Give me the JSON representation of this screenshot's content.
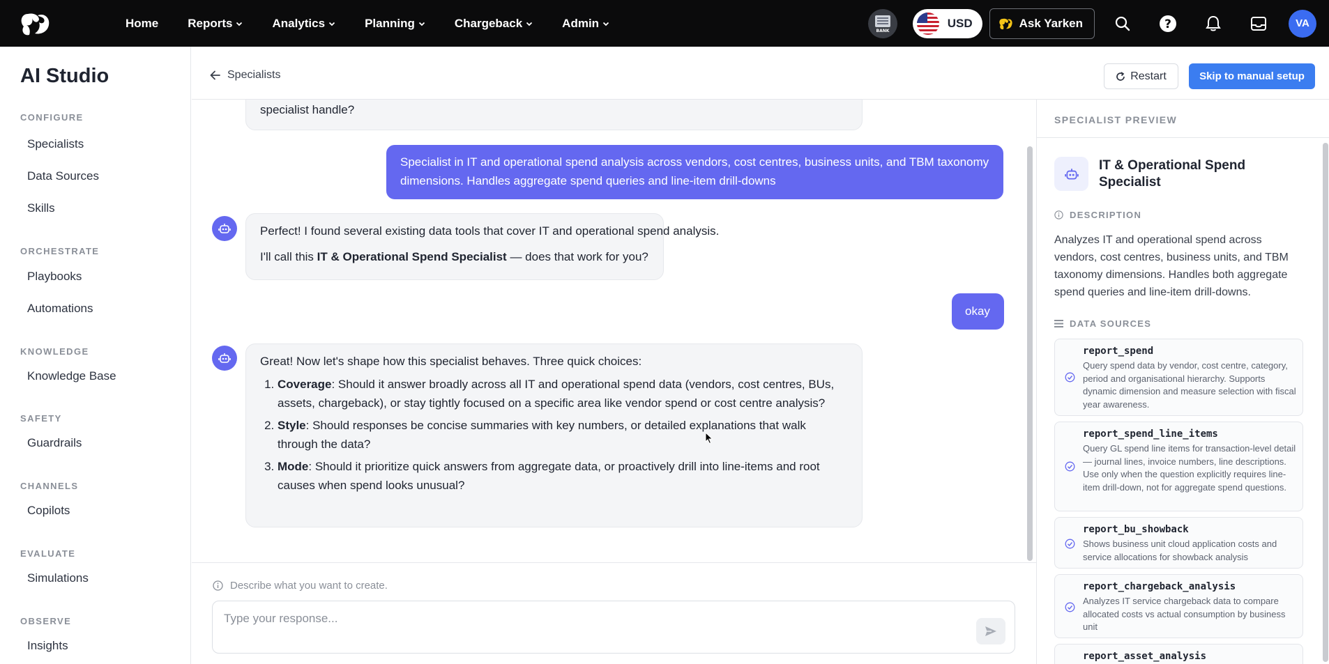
{
  "nav": {
    "links": [
      "Home",
      "Reports",
      "Analytics",
      "Planning",
      "Chargeback",
      "Admin"
    ],
    "bank_label": "BANK",
    "currency": "USD",
    "ask_label": "Ask Yarken",
    "avatar_initials": "VA",
    "colors": {
      "background": "#0b0b0c",
      "avatar": "#3b6cf1"
    }
  },
  "sidebar": {
    "title": "AI Studio",
    "sections": [
      {
        "label": "CONFIGURE",
        "items": [
          "Specialists",
          "Data Sources",
          "Skills"
        ]
      },
      {
        "label": "ORCHESTRATE",
        "items": [
          "Playbooks",
          "Automations"
        ]
      },
      {
        "label": "KNOWLEDGE",
        "items": [
          "Knowledge Base"
        ]
      },
      {
        "label": "SAFETY",
        "items": [
          "Guardrails"
        ]
      },
      {
        "label": "CHANNELS",
        "items": [
          "Copilots"
        ]
      },
      {
        "label": "EVALUATE",
        "items": [
          "Simulations"
        ]
      },
      {
        "label": "OBSERVE",
        "items": [
          "Insights"
        ]
      }
    ]
  },
  "header": {
    "back_label": "Specialists",
    "restart_label": "Restart",
    "skip_label": "Skip to manual setup",
    "accent": "#3b7df0"
  },
  "chat": {
    "partial_ai_tail": "specialist handle?",
    "user_msg_1": "Specialist in IT and operational spend analysis across vendors, cost centres, business units, and TBM taxonomy dimensions. Handles aggregate spend queries and line-item drill-downs",
    "ai_msg_2": {
      "line1": "Perfect! I found several existing data tools that cover IT and operational spend analysis.",
      "line2_pre": "I'll call this ",
      "line2_bold": "IT & Operational Spend Specialist",
      "line2_post": " — does that work for you?"
    },
    "user_msg_2": "okay",
    "ai_msg_3": {
      "intro": "Great! Now let's shape how this specialist behaves. Three quick choices:",
      "choices": [
        {
          "term": "Coverage",
          "text": ": Should it answer broadly across all IT and operational spend data (vendors, cost centres, BUs, assets, chargeback), or stay tightly focused on a specific area like vendor spend or cost centre analysis?"
        },
        {
          "term": "Style",
          "text": ": Should responses be concise summaries with key numbers, or detailed explanations that walk through the data?"
        },
        {
          "term": "Mode",
          "text": ": Should it prioritize quick answers from aggregate data, or proactively drill into line-items and root causes when spend looks unusual?"
        }
      ]
    },
    "user_color": "#6468f0"
  },
  "composer": {
    "hint": "Describe what you want to create.",
    "placeholder": "Type your response..."
  },
  "preview": {
    "heading": "SPECIALIST PREVIEW",
    "name": "IT & Operational Spend Specialist",
    "description_label": "DESCRIPTION",
    "description": "Analyzes IT and operational spend across vendors, cost centres, business units, and TBM taxonomy dimensions. Handles both aggregate spend queries and line-item drill-downs.",
    "data_sources_label": "DATA SOURCES",
    "data_sources": [
      {
        "name": "report_spend",
        "desc": "Query spend data by vendor, cost centre, category, period and organisational hierarchy. Supports dynamic dimension and measure selection with fiscal year awareness."
      },
      {
        "name": "report_spend_line_items",
        "desc": "Query GL spend line items for transaction-level detail — journal lines, invoice numbers, line descriptions. Use only when the question explicitly requires line-item drill-down, not for aggregate spend questions."
      },
      {
        "name": "report_bu_showback",
        "desc": "Shows business unit cloud application costs and service allocations for showback analysis"
      },
      {
        "name": "report_chargeback_analysis",
        "desc": "Analyzes IT service chargeback data to compare allocated costs vs actual consumption by business unit"
      },
      {
        "name": "report_asset_analysis",
        "desc": ""
      }
    ]
  }
}
